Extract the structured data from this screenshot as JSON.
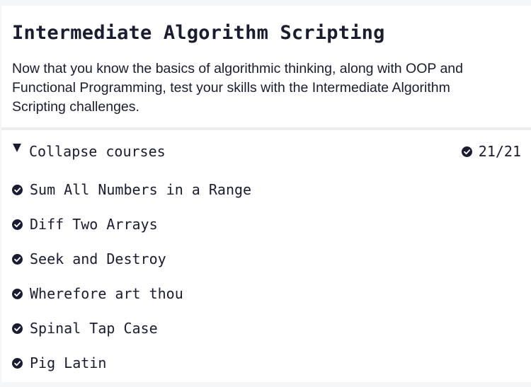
{
  "page": {
    "title": "Intermediate Algorithm Scripting",
    "description": "Now that you know the basics of algorithmic thinking, along with OOP and Functional Programming, test your skills with the Intermediate Algorithm Scripting challenges."
  },
  "courses": {
    "collapse_label": "Collapse courses",
    "progress": "21/21",
    "expanded": true,
    "check_icon": "check-circle-icon",
    "toggle_icon": "caret-down-icon"
  },
  "lessons": [
    {
      "title": "Sum All Numbers in a Range",
      "completed": true
    },
    {
      "title": "Diff Two Arrays",
      "completed": true
    },
    {
      "title": "Seek and Destroy",
      "completed": true
    },
    {
      "title": "Wherefore art thou",
      "completed": true
    },
    {
      "title": "Spinal Tap Case",
      "completed": true
    },
    {
      "title": "Pig Latin",
      "completed": true
    }
  ],
  "colors": {
    "text": "#1b1b32",
    "background": "#ffffff",
    "page_background": "#f5f6f7",
    "divider": "#eeeef0"
  }
}
